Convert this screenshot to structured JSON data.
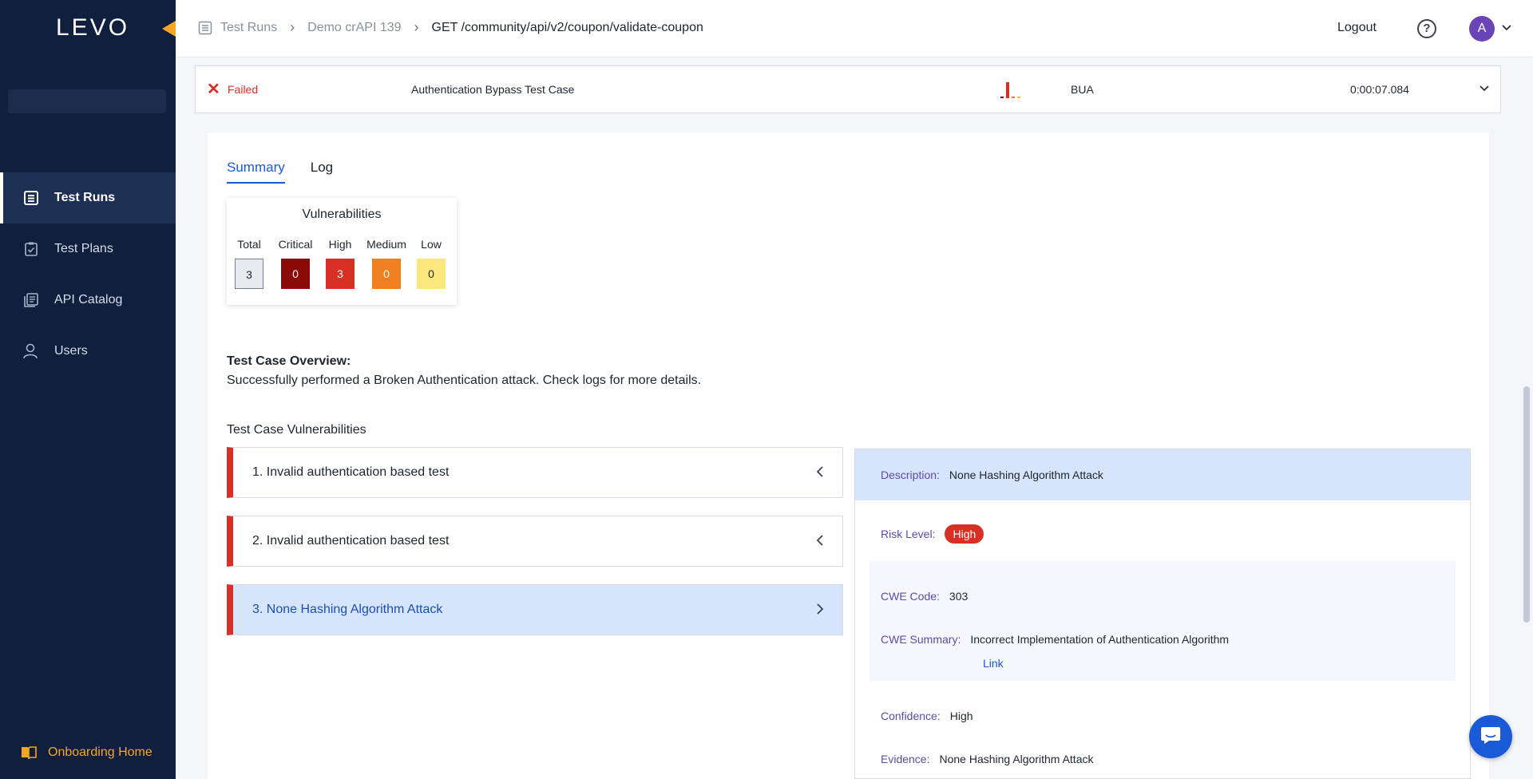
{
  "sidebar": {
    "logo": "LEVO",
    "items": [
      {
        "label": "Test Runs",
        "icon": "list-icon",
        "active": true
      },
      {
        "label": "Test Plans",
        "icon": "clipboard-icon"
      },
      {
        "label": "API Catalog",
        "icon": "catalog-icon"
      },
      {
        "label": "Users",
        "icon": "user-icon"
      }
    ],
    "onboarding": "Onboarding Home"
  },
  "header": {
    "breadcrumb": [
      "Test Runs",
      "Demo crAPI 139",
      "GET /community/api/v2/coupon/validate-coupon"
    ],
    "logout": "Logout",
    "help": "?",
    "avatar": "A"
  },
  "run": {
    "status": "Failed",
    "test_case": "Authentication Bypass Test Case",
    "category": "BUA",
    "duration": "0:00:07.084"
  },
  "tabs": [
    "Summary",
    "Log"
  ],
  "vulnerabilities": {
    "title": "Vulnerabilities",
    "columns": [
      {
        "label": "Total",
        "value": "3",
        "color": "#e7eaf0"
      },
      {
        "label": "Critical",
        "value": "0",
        "color": "#8b0a0a"
      },
      {
        "label": "High",
        "value": "3",
        "color": "#d93025"
      },
      {
        "label": "Medium",
        "value": "0",
        "color": "#f0801f"
      },
      {
        "label": "Low",
        "value": "0",
        "color": "#fbe77c"
      }
    ]
  },
  "overview": {
    "heading": "Test Case Overview:",
    "text": "Successfully performed a Broken Authentication attack. Check logs for more details."
  },
  "tc_vulns": {
    "heading": "Test Case Vulnerabilities",
    "items": [
      "1. Invalid authentication based test",
      "2. Invalid authentication based test",
      "3. None Hashing Algorithm Attack"
    ]
  },
  "detail": {
    "description_label": "Description:",
    "description": "None Hashing Algorithm Attack",
    "risk_label": "Risk Level:",
    "risk": "High",
    "cwe_code_label": "CWE Code:",
    "cwe_code": "303",
    "cwe_summary_label": "CWE Summary:",
    "cwe_summary": "Incorrect Implementation of Authentication Algorithm",
    "link": "Link",
    "confidence_label": "Confidence:",
    "confidence": "High",
    "evidence_label": "Evidence:",
    "evidence": "None Hashing Algorithm Attack"
  },
  "colors": {
    "accent": "#1a5ad7",
    "sidebar": "#0f1f3d",
    "danger": "#d93025",
    "brand_orange": "#f5a623"
  }
}
